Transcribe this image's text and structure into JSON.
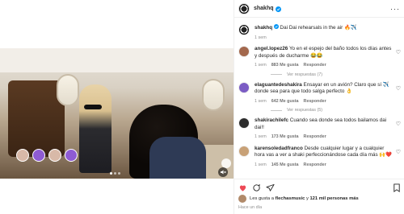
{
  "video": {
    "dots": 3,
    "active_dot": 1
  },
  "header": {
    "username": "shakhq"
  },
  "caption": {
    "username": "shakhq",
    "text": "Dai Dai rehearsals in the air 🔥✈️",
    "time": "1 sem"
  },
  "comments": [
    {
      "username": "angel.lopez26",
      "text": "Yo en el espejo del baño todos los días antes y después de ducharme 😂😂",
      "time": "1 sem",
      "likes": "883 Me gusta",
      "reply": "Responder",
      "replies": "Ver respuestas (7)",
      "avatar_color": "#a3684d"
    },
    {
      "username": "elaguantedeshakira",
      "text": "Ensayar en un avión? Claro que sí ✈️ donde sea para que todo salga perfecto 👌",
      "time": "1 sem",
      "likes": "642 Me gusta",
      "reply": "Responder",
      "replies": "Ver respuestas (5)",
      "avatar_color": "#7b5cc4"
    },
    {
      "username": "shakirachilefc",
      "text": "Cuando sea donde sea todos bailamos dai dai!!",
      "time": "1 sem",
      "likes": "173 Me gusta",
      "reply": "Responder",
      "replies": "",
      "avatar_color": "#2c2c2c"
    },
    {
      "username": "karensoledadfranco",
      "text": "Desde cualquier lugar y a cualquier hora vas a ver a shaki perfeccionándose cada día más 🙌❤️",
      "time": "1 sem",
      "likes": "145 Me gusta",
      "reply": "Responder",
      "replies": "",
      "avatar_color": "#c8a177"
    }
  ],
  "footer": {
    "likes_prefix": "Les gusta a ",
    "likes_user": "flechasmusic",
    "likes_mid": " y ",
    "likes_count": "121 mil personas más",
    "time": "Hace un día"
  },
  "colors": {
    "accent": "#0095f6",
    "heart": "#ed4956"
  }
}
